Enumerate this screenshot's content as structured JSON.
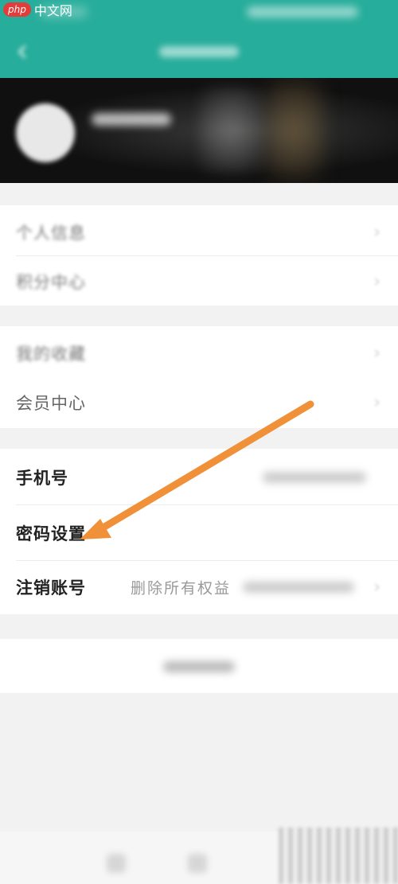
{
  "watermark": {
    "brand": "php",
    "text": "中文网"
  },
  "menu": {
    "group1": [
      {
        "label": "个人信息",
        "blurred": true
      },
      {
        "label": "积分中心",
        "blurred": true
      }
    ],
    "group2": [
      {
        "label": "我的收藏",
        "blurred": true
      },
      {
        "label": "会员中心",
        "blurred": false
      }
    ],
    "group3": [
      {
        "label": "手机号"
      },
      {
        "label": "密码设置"
      },
      {
        "label": "注销账号",
        "value": "删除所有权益"
      }
    ]
  },
  "colors": {
    "header": "#27ad9b",
    "arrow": "#f0913a",
    "background": "#f2f2f2"
  },
  "icons": {
    "back": "back-arrow-icon",
    "chevron": "chevron-right-icon"
  }
}
